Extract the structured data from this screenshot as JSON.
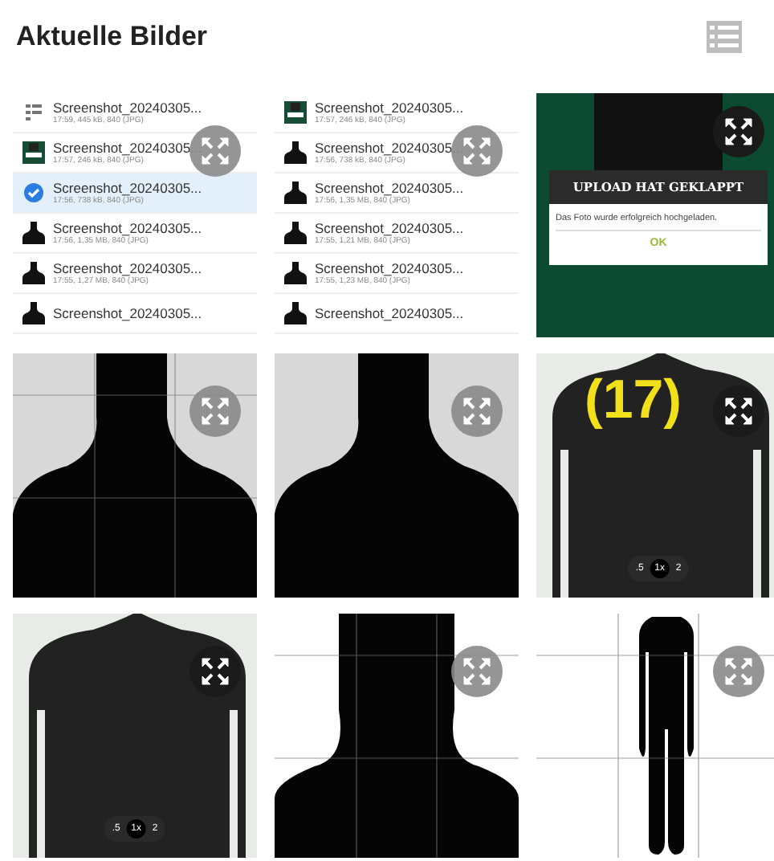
{
  "header": {
    "title": "Aktuelle Bilder"
  },
  "tiles": [
    {
      "kind": "file-list",
      "rows": [
        {
          "name": "Screenshot_20240305...",
          "meta": "17:59, 445 kB, 840 (JPG)",
          "kind": "list",
          "selected": false
        },
        {
          "name": "Screenshot_20240305...",
          "meta": "17:57, 246 kB, 840 (JPG)",
          "kind": "green",
          "selected": false
        },
        {
          "name": "Screenshot_20240305...",
          "meta": "17:56, 738 kB, 840 (JPG)",
          "selected": true
        },
        {
          "name": "Screenshot_20240305...",
          "meta": "17:56, 1,35 MB, 840 (JPG)",
          "kind": "person",
          "selected": false
        },
        {
          "name": "Screenshot_20240305...",
          "meta": "17:55, 1,27 MB, 840 (JPG)",
          "kind": "person",
          "selected": false
        },
        {
          "name": "Screenshot_20240305...",
          "kind": "person",
          "selected": false
        }
      ]
    },
    {
      "kind": "file-list",
      "rows": [
        {
          "name": "Screenshot_20240305...",
          "meta": "17:57, 246 kB, 840 (JPG)",
          "kind": "green",
          "selected": false
        },
        {
          "name": "Screenshot_20240305...",
          "meta": "17:56, 738 kB, 840 (JPG)",
          "kind": "person",
          "selected": false
        },
        {
          "name": "Screenshot_20240305...",
          "meta": "17:56, 1,35 MB, 840 (JPG)",
          "kind": "person",
          "selected": false
        },
        {
          "name": "Screenshot_20240305...",
          "meta": "17:55, 1,21 MB, 840 (JPG)",
          "kind": "person",
          "selected": false
        },
        {
          "name": "Screenshot_20240305...",
          "meta": "17:55, 1,23 MB, 840 (JPG)",
          "kind": "person",
          "selected": false
        },
        {
          "name": "Screenshot_20240305...",
          "kind": "person",
          "selected": false
        }
      ]
    },
    {
      "kind": "dialog",
      "title": "UPLOAD HAT GEKLAPPT",
      "message": "Das Foto wurde erfolgreich hochgeladen.",
      "button": "OK"
    },
    {
      "kind": "bust",
      "grid": true
    },
    {
      "kind": "bust",
      "grid": false
    },
    {
      "kind": "torso",
      "grid": false,
      "label": "(17)",
      "zoom": [
        ".5",
        "1x",
        "2"
      ]
    },
    {
      "kind": "torso",
      "grid": false,
      "zoom": [
        ".5",
        "1x",
        "2"
      ]
    },
    {
      "kind": "head",
      "grid": true
    },
    {
      "kind": "body",
      "grid": true
    }
  ]
}
